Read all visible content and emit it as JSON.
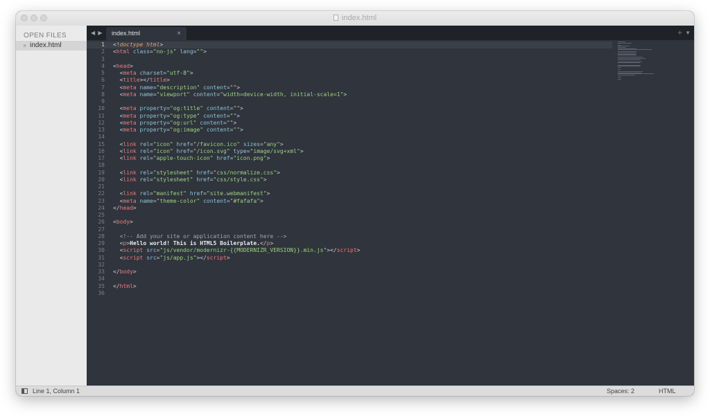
{
  "window": {
    "title": "index.html"
  },
  "sidebar": {
    "heading": "OPEN FILES",
    "files": [
      {
        "name": "index.html",
        "close_glyph": "×"
      }
    ]
  },
  "tabs": {
    "nav_glyph": "◀ ▶",
    "active": {
      "label": "index.html",
      "close_glyph": "×"
    },
    "plus_glyph": "+",
    "menu_glyph": "▼"
  },
  "editor": {
    "active_line": 1,
    "line_numbers": [
      "1",
      "2",
      "3",
      "4",
      "5",
      "6",
      "7",
      "8",
      "9",
      "10",
      "11",
      "12",
      "13",
      "14",
      "15",
      "16",
      "17",
      "18",
      "19",
      "20",
      "21",
      "22",
      "23",
      "24",
      "25",
      "26",
      "27",
      "28",
      "29",
      "30",
      "31",
      "32",
      "33",
      "34",
      "35",
      "36"
    ],
    "lines": [
      [
        [
          "pun",
          "<!"
        ],
        [
          "kw",
          "doctype html"
        ],
        [
          "pun",
          ">"
        ]
      ],
      [
        [
          "pun",
          "<"
        ],
        [
          "tag",
          "html"
        ],
        [
          "attr",
          " class"
        ],
        [
          "pun",
          "="
        ],
        [
          "str",
          "\"no-js\""
        ],
        [
          "attr",
          " lang"
        ],
        [
          "pun",
          "="
        ],
        [
          "str",
          "\"\""
        ],
        [
          "pun",
          ">"
        ]
      ],
      [],
      [
        [
          "pun",
          "<"
        ],
        [
          "tag",
          "head"
        ],
        [
          "pun",
          ">"
        ]
      ],
      [
        [
          "txt",
          "  "
        ],
        [
          "pun",
          "<"
        ],
        [
          "tag",
          "meta"
        ],
        [
          "attr",
          " charset"
        ],
        [
          "pun",
          "="
        ],
        [
          "str",
          "\"utf-8\""
        ],
        [
          "pun",
          ">"
        ]
      ],
      [
        [
          "txt",
          "  "
        ],
        [
          "pun",
          "<"
        ],
        [
          "tag",
          "title"
        ],
        [
          "pun",
          "></"
        ],
        [
          "tag",
          "title"
        ],
        [
          "pun",
          ">"
        ]
      ],
      [
        [
          "txt",
          "  "
        ],
        [
          "pun",
          "<"
        ],
        [
          "tag",
          "meta"
        ],
        [
          "attr",
          " name"
        ],
        [
          "pun",
          "="
        ],
        [
          "str",
          "\"description\""
        ],
        [
          "attr",
          " content"
        ],
        [
          "pun",
          "="
        ],
        [
          "str",
          "\"\""
        ],
        [
          "pun",
          ">"
        ]
      ],
      [
        [
          "txt",
          "  "
        ],
        [
          "pun",
          "<"
        ],
        [
          "tag",
          "meta"
        ],
        [
          "attr",
          " name"
        ],
        [
          "pun",
          "="
        ],
        [
          "str",
          "\"viewport\""
        ],
        [
          "attr",
          " content"
        ],
        [
          "pun",
          "="
        ],
        [
          "str",
          "\"width=device-width, initial-scale=1\""
        ],
        [
          "pun",
          ">"
        ]
      ],
      [],
      [
        [
          "txt",
          "  "
        ],
        [
          "pun",
          "<"
        ],
        [
          "tag",
          "meta"
        ],
        [
          "attr",
          " property"
        ],
        [
          "pun",
          "="
        ],
        [
          "str",
          "\"og:title\""
        ],
        [
          "attr",
          " content"
        ],
        [
          "pun",
          "="
        ],
        [
          "str",
          "\"\""
        ],
        [
          "pun",
          ">"
        ]
      ],
      [
        [
          "txt",
          "  "
        ],
        [
          "pun",
          "<"
        ],
        [
          "tag",
          "meta"
        ],
        [
          "attr",
          " property"
        ],
        [
          "pun",
          "="
        ],
        [
          "str",
          "\"og:type\""
        ],
        [
          "attr",
          " content"
        ],
        [
          "pun",
          "="
        ],
        [
          "str",
          "\"\""
        ],
        [
          "pun",
          ">"
        ]
      ],
      [
        [
          "txt",
          "  "
        ],
        [
          "pun",
          "<"
        ],
        [
          "tag",
          "meta"
        ],
        [
          "attr",
          " property"
        ],
        [
          "pun",
          "="
        ],
        [
          "str",
          "\"og:url\""
        ],
        [
          "attr",
          " content"
        ],
        [
          "pun",
          "="
        ],
        [
          "str",
          "\"\""
        ],
        [
          "pun",
          ">"
        ]
      ],
      [
        [
          "txt",
          "  "
        ],
        [
          "pun",
          "<"
        ],
        [
          "tag",
          "meta"
        ],
        [
          "attr",
          " property"
        ],
        [
          "pun",
          "="
        ],
        [
          "str",
          "\"og:image\""
        ],
        [
          "attr",
          " content"
        ],
        [
          "pun",
          "="
        ],
        [
          "str",
          "\"\""
        ],
        [
          "pun",
          ">"
        ]
      ],
      [],
      [
        [
          "txt",
          "  "
        ],
        [
          "pun",
          "<"
        ],
        [
          "tag",
          "link"
        ],
        [
          "attr",
          " rel"
        ],
        [
          "pun",
          "="
        ],
        [
          "str",
          "\"icon\""
        ],
        [
          "attr",
          " href"
        ],
        [
          "pun",
          "="
        ],
        [
          "str",
          "\"/favicon.ico\""
        ],
        [
          "attr",
          " sizes"
        ],
        [
          "pun",
          "="
        ],
        [
          "str",
          "\"any\""
        ],
        [
          "pun",
          ">"
        ]
      ],
      [
        [
          "txt",
          "  "
        ],
        [
          "pun",
          "<"
        ],
        [
          "tag",
          "link"
        ],
        [
          "attr",
          " rel"
        ],
        [
          "pun",
          "="
        ],
        [
          "str",
          "\"icon\""
        ],
        [
          "attr",
          " href"
        ],
        [
          "pun",
          "="
        ],
        [
          "str",
          "\"/icon.svg\""
        ],
        [
          "attr",
          " type"
        ],
        [
          "pun",
          "="
        ],
        [
          "str",
          "\"image/svg+xml\""
        ],
        [
          "pun",
          ">"
        ]
      ],
      [
        [
          "txt",
          "  "
        ],
        [
          "pun",
          "<"
        ],
        [
          "tag",
          "link"
        ],
        [
          "attr",
          " rel"
        ],
        [
          "pun",
          "="
        ],
        [
          "str",
          "\"apple-touch-icon\""
        ],
        [
          "attr",
          " href"
        ],
        [
          "pun",
          "="
        ],
        [
          "str",
          "\"icon.png\""
        ],
        [
          "pun",
          ">"
        ]
      ],
      [],
      [
        [
          "txt",
          "  "
        ],
        [
          "pun",
          "<"
        ],
        [
          "tag",
          "link"
        ],
        [
          "attr",
          " rel"
        ],
        [
          "pun",
          "="
        ],
        [
          "str",
          "\"stylesheet\""
        ],
        [
          "attr",
          " href"
        ],
        [
          "pun",
          "="
        ],
        [
          "str",
          "\"css/normalize.css\""
        ],
        [
          "pun",
          ">"
        ]
      ],
      [
        [
          "txt",
          "  "
        ],
        [
          "pun",
          "<"
        ],
        [
          "tag",
          "link"
        ],
        [
          "attr",
          " rel"
        ],
        [
          "pun",
          "="
        ],
        [
          "str",
          "\"stylesheet\""
        ],
        [
          "attr",
          " href"
        ],
        [
          "pun",
          "="
        ],
        [
          "str",
          "\"css/style.css\""
        ],
        [
          "pun",
          ">"
        ]
      ],
      [],
      [
        [
          "txt",
          "  "
        ],
        [
          "pun",
          "<"
        ],
        [
          "tag",
          "link"
        ],
        [
          "attr",
          " rel"
        ],
        [
          "pun",
          "="
        ],
        [
          "str",
          "\"manifest\""
        ],
        [
          "attr",
          " href"
        ],
        [
          "pun",
          "="
        ],
        [
          "str",
          "\"site.webmanifest\""
        ],
        [
          "pun",
          ">"
        ]
      ],
      [
        [
          "txt",
          "  "
        ],
        [
          "pun",
          "<"
        ],
        [
          "tag",
          "meta"
        ],
        [
          "attr",
          " name"
        ],
        [
          "pun",
          "="
        ],
        [
          "str",
          "\"theme-color\""
        ],
        [
          "attr",
          " content"
        ],
        [
          "pun",
          "="
        ],
        [
          "str",
          "\"#fafafa\""
        ],
        [
          "pun",
          ">"
        ]
      ],
      [
        [
          "pun",
          "</"
        ],
        [
          "tag",
          "head"
        ],
        [
          "pun",
          ">"
        ]
      ],
      [],
      [
        [
          "pun",
          "<"
        ],
        [
          "tag",
          "body"
        ],
        [
          "pun",
          ">"
        ]
      ],
      [],
      [
        [
          "txt",
          "  "
        ],
        [
          "cmt",
          "<!-- Add your site or application content here -->"
        ]
      ],
      [
        [
          "txt",
          "  "
        ],
        [
          "pun",
          "<"
        ],
        [
          "tag",
          "p"
        ],
        [
          "pun",
          ">"
        ],
        [
          "bold",
          "Hello world! This is HTML5 Boilerplate."
        ],
        [
          "pun",
          "</"
        ],
        [
          "tag",
          "p"
        ],
        [
          "pun",
          ">"
        ]
      ],
      [
        [
          "txt",
          "  "
        ],
        [
          "pun",
          "<"
        ],
        [
          "tag",
          "script"
        ],
        [
          "attr",
          " src"
        ],
        [
          "pun",
          "="
        ],
        [
          "str",
          "\"js/vendor/modernizr-{{MODERNIZR_VERSION}}.min.js\""
        ],
        [
          "pun",
          "></"
        ],
        [
          "tag",
          "script"
        ],
        [
          "pun",
          ">"
        ]
      ],
      [
        [
          "txt",
          "  "
        ],
        [
          "pun",
          "<"
        ],
        [
          "tag",
          "script"
        ],
        [
          "attr",
          " src"
        ],
        [
          "pun",
          "="
        ],
        [
          "str",
          "\"js/app.js\""
        ],
        [
          "pun",
          "></"
        ],
        [
          "tag",
          "script"
        ],
        [
          "pun",
          ">"
        ]
      ],
      [],
      [
        [
          "pun",
          "</"
        ],
        [
          "tag",
          "body"
        ],
        [
          "pun",
          ">"
        ]
      ],
      [],
      [
        [
          "pun",
          "</"
        ],
        [
          "tag",
          "html"
        ],
        [
          "pun",
          ">"
        ]
      ],
      []
    ]
  },
  "statusbar": {
    "position": "Line 1, Column 1",
    "indentation": "Spaces: 2",
    "syntax": "HTML"
  },
  "colors": {
    "editor_bg": "#2f343d",
    "tag": "#f07a7a",
    "attr": "#8fc3d4",
    "string": "#9fd37f",
    "keyword": "#e2a06b"
  }
}
